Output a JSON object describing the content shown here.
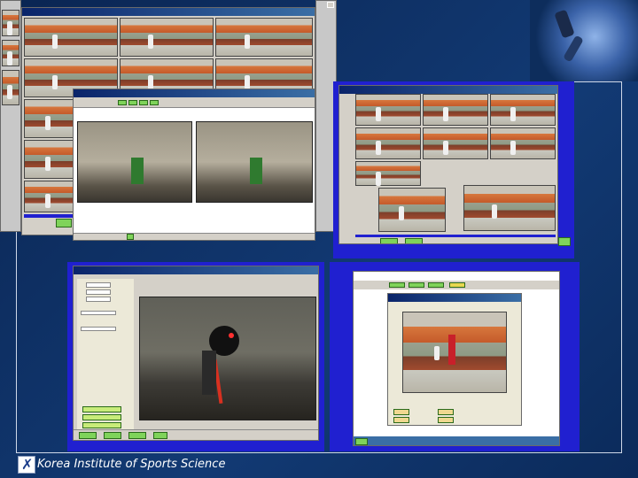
{
  "caption": {
    "text": "Korea Institute of Sports Science"
  },
  "decorative_image": {
    "name": "athlete-photo"
  },
  "colors": {
    "background": "#0d2d5c",
    "frame_line": "#cfd8e8",
    "button_green": "#7fd35a",
    "accent_blue": "#2020d0"
  }
}
